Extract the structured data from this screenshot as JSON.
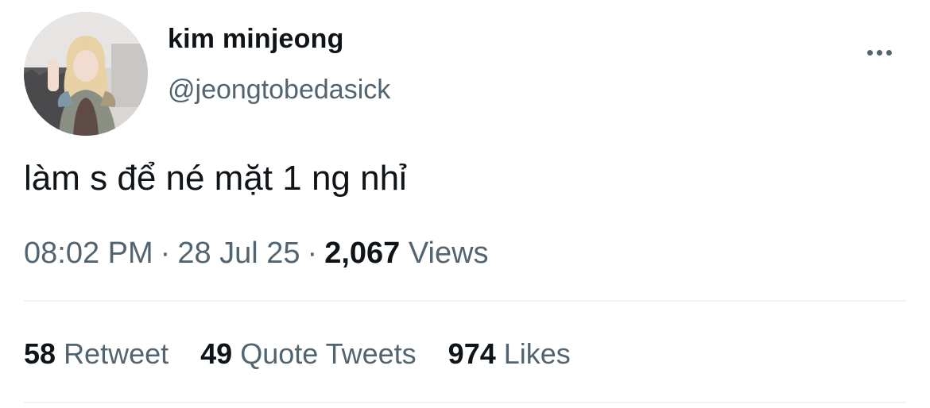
{
  "user": {
    "display_name": "kim minjeong",
    "handle": "@jeongtobedasick",
    "avatar_icon": "profile-photo"
  },
  "tweet": {
    "text": "làm s để né mặt 1 ng nhỉ"
  },
  "meta": {
    "time": "08:02 PM",
    "separator": "·",
    "date": "28 Jul 25",
    "views_count": "2,067",
    "views_label": "Views"
  },
  "stats": {
    "retweets_count": "58",
    "retweets_label": "Retweet",
    "quotes_count": "49",
    "quotes_label": "Quote Tweets",
    "likes_count": "974",
    "likes_label": "Likes"
  },
  "colors": {
    "text_primary": "#0f1419",
    "text_secondary": "#536471",
    "divider": "#eff3f4",
    "background": "#ffffff"
  },
  "icons": {
    "more": "more-horizontal-icon"
  }
}
